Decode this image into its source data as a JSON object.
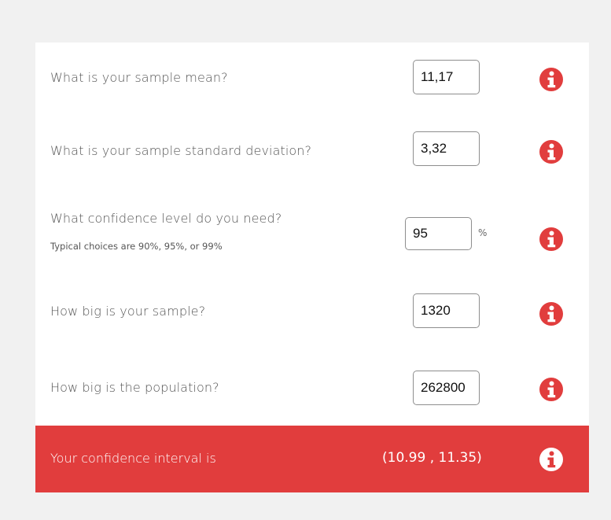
{
  "form": {
    "questions": [
      {
        "label": "What is your sample mean?",
        "value": "11,17"
      },
      {
        "label": "What is your sample standard deviation?",
        "value": "3,32"
      },
      {
        "label": "What confidence level do you need?",
        "hint": "Typical choices are 90%, 95%, or 99%",
        "value": "95",
        "unit": "%"
      },
      {
        "label": "How big is your sample?",
        "value": "1320"
      },
      {
        "label": "How big is the population?",
        "value": "262800"
      }
    ]
  },
  "result": {
    "label": "Your confidence interval is",
    "value": "(10.99 , 11.35)"
  },
  "colors": {
    "accent": "#e13d3d",
    "background": "#f1f1f1",
    "card": "#ffffff"
  },
  "icons": {
    "info": "info-circle-icon"
  }
}
